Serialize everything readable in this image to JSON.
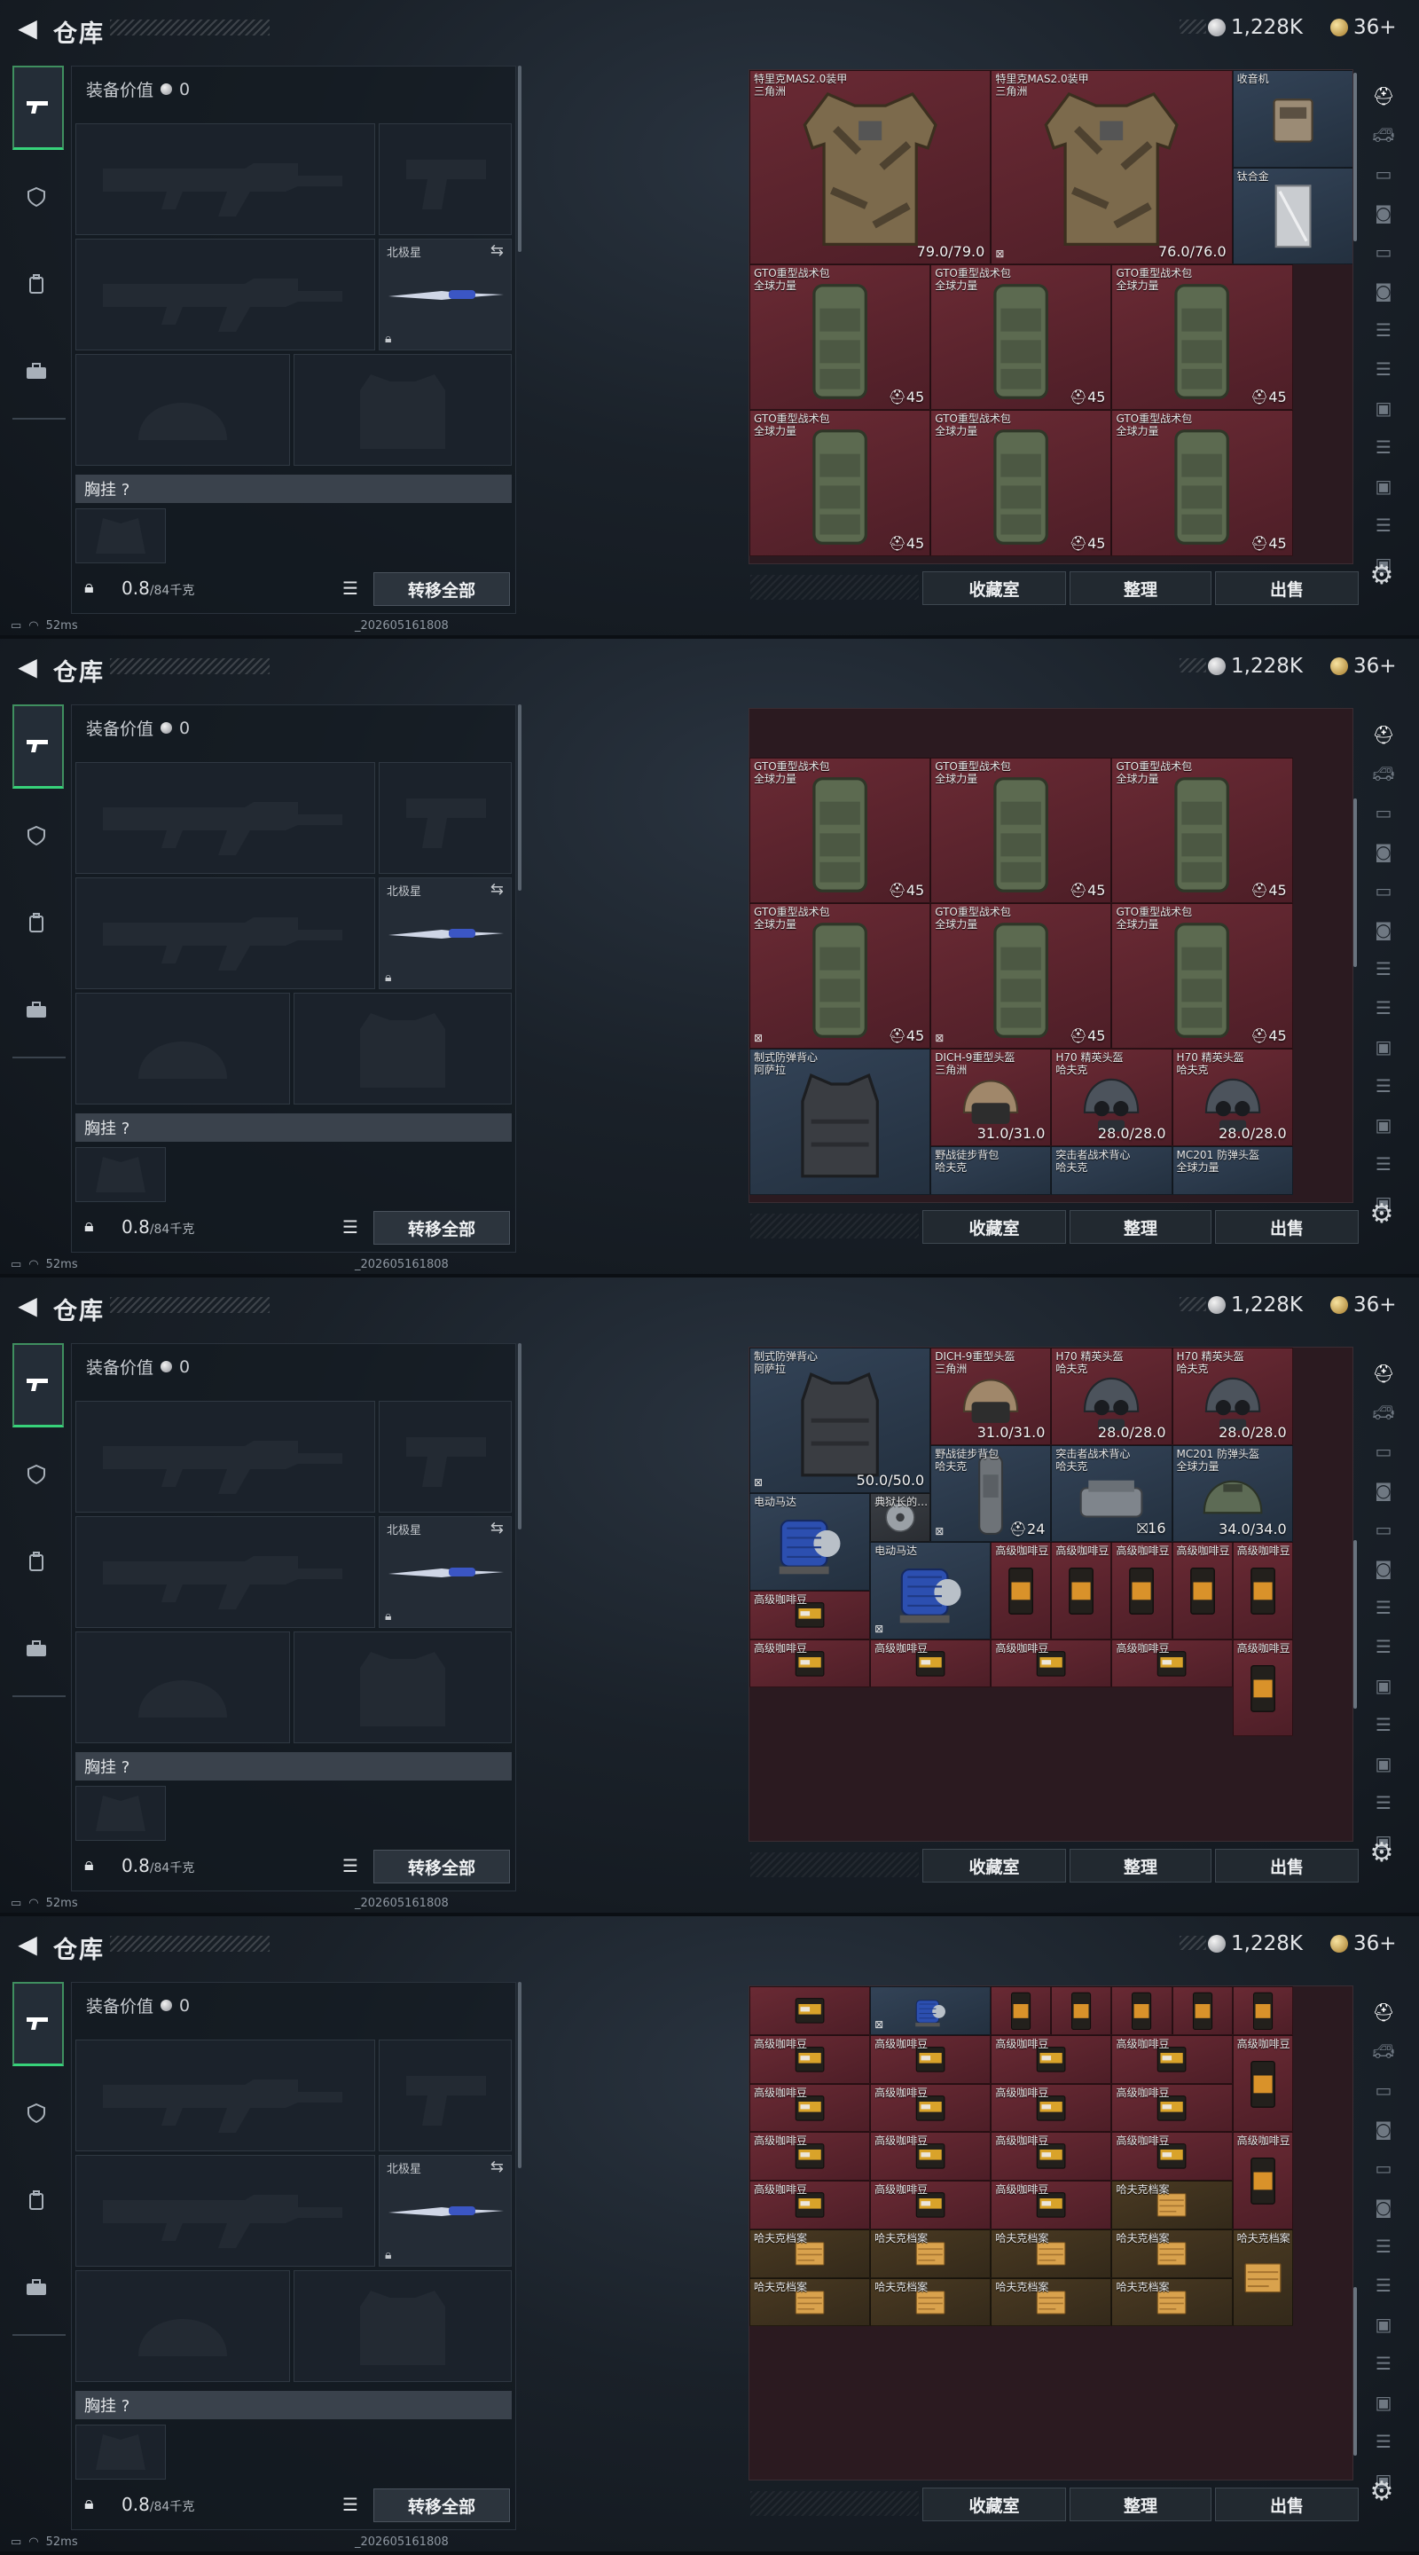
{
  "header": {
    "back_icon": "back-arrow-icon",
    "title": "仓库"
  },
  "currency": {
    "silver": "1,228K",
    "gold": "36+"
  },
  "sidebar": {
    "tabs": [
      {
        "icon": "gun-icon",
        "active": true
      },
      {
        "icon": "shield-badge-icon",
        "active": false
      },
      {
        "icon": "backpack-icon",
        "active": false
      },
      {
        "icon": "briefcase-icon",
        "active": false
      }
    ]
  },
  "equipment": {
    "value_label": "装备价值",
    "value": "0",
    "knife_label": "北极星",
    "chest_label": "胸挂 ?",
    "weight": "0.8",
    "weight_unit": "/84千克",
    "transfer_all": "转移全部"
  },
  "actions": {
    "collect": "收藏室",
    "sort": "整理",
    "sell": "出售"
  },
  "status": {
    "ping": "52ms",
    "build": "_202605161808"
  },
  "right_rail": [
    "helmet-icon",
    "car-icon",
    "tv-icon",
    "camera-icon",
    "tv-icon",
    "camera-icon",
    "server-icon",
    "server-icon",
    "image-icon",
    "server-icon",
    "image-icon",
    "server-icon",
    "image-icon"
  ],
  "colors": {
    "accent_green": "#37d27a",
    "rarity_red": "#5b222c",
    "rarity_blue": "#2b3a4c",
    "rarity_yellow": "#3f3220"
  },
  "frames": [
    {
      "scroll_offset": 0,
      "items": [
        {
          "r": 0,
          "c": 0,
          "w": 2,
          "h": 2,
          "name": "特里克MAS2.0装甲",
          "sub": "三角洲",
          "kind": "armor-camo",
          "rarity": "red",
          "val": "79.0/79.0"
        },
        {
          "r": 0,
          "c": 2,
          "w": 2,
          "h": 2,
          "name": "特里克MAS2.0装甲",
          "sub": "三角洲",
          "kind": "armor-camo",
          "rarity": "red",
          "val": "76.0/76.0",
          "icon": "⊠"
        },
        {
          "r": 0,
          "c": 4,
          "w": 1,
          "h": 1,
          "name": "收音机",
          "sub": "",
          "kind": "radio",
          "rarity": "blue",
          "val": ""
        },
        {
          "r": 1,
          "c": 4,
          "w": 1,
          "h": 1,
          "name": "钛合金",
          "sub": "",
          "kind": "metal",
          "rarity": "blue",
          "val": ""
        },
        {
          "r": 2,
          "c": 0,
          "w": 1.5,
          "h": 1.5,
          "name": "GTO重型战术包",
          "sub": "全球力量",
          "kind": "backpack",
          "rarity": "red",
          "val": "⛑45"
        },
        {
          "r": 2,
          "c": 1.5,
          "w": 1.5,
          "h": 1.5,
          "name": "GTO重型战术包",
          "sub": "全球力量",
          "kind": "backpack",
          "rarity": "red",
          "val": "⛑45"
        },
        {
          "r": 2,
          "c": 3,
          "w": 1.5,
          "h": 1.5,
          "name": "GTO重型战术包",
          "sub": "全球力量",
          "kind": "backpack",
          "rarity": "red",
          "val": "⛑45"
        },
        {
          "r": 3.5,
          "c": 0,
          "w": 1.5,
          "h": 1.5,
          "name": "GTO重型战术包",
          "sub": "全球力量",
          "kind": "backpack",
          "rarity": "red",
          "val": "⛑45"
        },
        {
          "r": 3.5,
          "c": 1.5,
          "w": 1.5,
          "h": 1.5,
          "name": "GTO重型战术包",
          "sub": "全球力量",
          "kind": "backpack",
          "rarity": "red",
          "val": "⛑45"
        },
        {
          "r": 3.5,
          "c": 3,
          "w": 1.5,
          "h": 1.5,
          "name": "GTO重型战术包",
          "sub": "全球力量",
          "kind": "backpack",
          "rarity": "red",
          "val": "⛑45"
        }
      ]
    },
    {
      "scroll_offset": 1.6,
      "items": [
        {
          "r": 0.5,
          "c": 0,
          "w": 1.5,
          "h": 1.5,
          "name": "GTO重型战术包",
          "sub": "全球力量",
          "kind": "backpack",
          "rarity": "red",
          "val": "⛑45"
        },
        {
          "r": 0.5,
          "c": 1.5,
          "w": 1.5,
          "h": 1.5,
          "name": "GTO重型战术包",
          "sub": "全球力量",
          "kind": "backpack",
          "rarity": "red",
          "val": "⛑45"
        },
        {
          "r": 0.5,
          "c": 3,
          "w": 1.5,
          "h": 1.5,
          "name": "GTO重型战术包",
          "sub": "全球力量",
          "kind": "backpack",
          "rarity": "red",
          "val": "⛑45"
        },
        {
          "r": 2,
          "c": 0,
          "w": 1.5,
          "h": 1.5,
          "name": "GTO重型战术包",
          "sub": "全球力量",
          "kind": "backpack",
          "rarity": "red",
          "val": "⛑45",
          "icon": "⊠"
        },
        {
          "r": 2,
          "c": 1.5,
          "w": 1.5,
          "h": 1.5,
          "name": "GTO重型战术包",
          "sub": "全球力量",
          "kind": "backpack",
          "rarity": "red",
          "val": "⛑45",
          "icon": "⊠"
        },
        {
          "r": 2,
          "c": 3,
          "w": 1.5,
          "h": 1.5,
          "name": "GTO重型战术包",
          "sub": "全球力量",
          "kind": "backpack",
          "rarity": "red",
          "val": "⛑45"
        },
        {
          "r": 3.5,
          "c": 0,
          "w": 1.5,
          "h": 1.5,
          "name": "制式防弹背心",
          "sub": "阿萨拉",
          "kind": "vest",
          "rarity": "blue",
          "val": ""
        },
        {
          "r": 3.5,
          "c": 1.5,
          "w": 1,
          "h": 1,
          "name": "DICH-9重型头盔",
          "sub": "三角洲",
          "kind": "helmet-tan",
          "rarity": "red",
          "val": "31.0/31.0"
        },
        {
          "r": 3.5,
          "c": 2.5,
          "w": 1,
          "h": 1,
          "name": "H70 精英头盔",
          "sub": "哈夫克",
          "kind": "helmet-dark",
          "rarity": "red",
          "val": "28.0/28.0"
        },
        {
          "r": 3.5,
          "c": 3.5,
          "w": 1,
          "h": 1,
          "name": "H70 精英头盔",
          "sub": "哈夫克",
          "kind": "helmet-dark",
          "rarity": "red",
          "val": "28.0/28.0"
        },
        {
          "r": 4.5,
          "c": 1.5,
          "w": 1,
          "h": 0.5,
          "name": "野战徒步背包",
          "sub": "哈夫克",
          "kind": "none",
          "rarity": "blue",
          "val": ""
        },
        {
          "r": 4.5,
          "c": 2.5,
          "w": 1,
          "h": 0.5,
          "name": "突击者战术背心",
          "sub": "哈夫克",
          "kind": "none",
          "rarity": "blue",
          "val": ""
        },
        {
          "r": 4.5,
          "c": 3.5,
          "w": 1,
          "h": 0.5,
          "name": "MC201 防弹头盔",
          "sub": "全球力量",
          "kind": "none",
          "rarity": "blue",
          "val": ""
        }
      ]
    },
    {
      "scroll_offset": 3.5,
      "items": [
        {
          "r": 0,
          "c": 0,
          "w": 1.5,
          "h": 1.5,
          "name": "制式防弹背心",
          "sub": "阿萨拉",
          "kind": "vest",
          "rarity": "blue",
          "val": "50.0/50.0",
          "icon": "⊠"
        },
        {
          "r": 0,
          "c": 1.5,
          "w": 1,
          "h": 1,
          "name": "DICH-9重型头盔",
          "sub": "三角洲",
          "kind": "helmet-tan",
          "rarity": "red",
          "val": "31.0/31.0"
        },
        {
          "r": 0,
          "c": 2.5,
          "w": 1,
          "h": 1,
          "name": "H70 精英头盔",
          "sub": "哈夫克",
          "kind": "helmet-dark",
          "rarity": "red",
          "val": "28.0/28.0"
        },
        {
          "r": 0,
          "c": 3.5,
          "w": 1,
          "h": 1,
          "name": "H70 精英头盔",
          "sub": "哈夫克",
          "kind": "helmet-dark",
          "rarity": "red",
          "val": "28.0/28.0"
        },
        {
          "r": 1,
          "c": 1.5,
          "w": 1,
          "h": 1,
          "name": "野战徒步背包",
          "sub": "哈夫克",
          "kind": "bag-gray",
          "rarity": "blue",
          "val": "⛑24",
          "icon": "⊠"
        },
        {
          "r": 1,
          "c": 2.5,
          "w": 1,
          "h": 1,
          "name": "突击者战术背心",
          "sub": "哈夫克",
          "kind": "vest-gray",
          "rarity": "blue",
          "val": "⛝16"
        },
        {
          "r": 1,
          "c": 3.5,
          "w": 1,
          "h": 1,
          "name": "MC201 防弹头盔",
          "sub": "全球力量",
          "kind": "helmet-green",
          "rarity": "blue",
          "val": "34.0/34.0"
        },
        {
          "r": 1.5,
          "c": 0,
          "w": 1,
          "h": 1,
          "name": "电动马达",
          "sub": "",
          "kind": "motor",
          "rarity": "blue",
          "val": ""
        },
        {
          "r": 1.5,
          "c": 1,
          "w": 0.5,
          "h": 0.5,
          "name": "典狱长的…",
          "sub": "",
          "kind": "disc",
          "rarity": "gray",
          "val": ""
        },
        {
          "r": 2,
          "c": 1,
          "w": 1,
          "h": 1,
          "name": "电动马达",
          "sub": "",
          "kind": "motor",
          "rarity": "blue",
          "val": "",
          "icon": "⊠"
        },
        {
          "r": 2,
          "c": 2,
          "w": 0.5,
          "h": 1,
          "name": "高级咖啡豆",
          "sub": "",
          "kind": "coffee-tall",
          "rarity": "red",
          "val": ""
        },
        {
          "r": 2,
          "c": 2.5,
          "w": 0.5,
          "h": 1,
          "name": "高级咖啡豆",
          "sub": "",
          "kind": "coffee-tall",
          "rarity": "red",
          "val": ""
        },
        {
          "r": 2,
          "c": 3,
          "w": 0.5,
          "h": 1,
          "name": "高级咖啡豆",
          "sub": "",
          "kind": "coffee-tall",
          "rarity": "red",
          "val": ""
        },
        {
          "r": 2,
          "c": 3.5,
          "w": 0.5,
          "h": 1,
          "name": "高级咖啡豆",
          "sub": "",
          "kind": "coffee-tall",
          "rarity": "red",
          "val": ""
        },
        {
          "r": 2,
          "c": 4,
          "w": 0.5,
          "h": 1,
          "name": "高级咖啡豆",
          "sub": "",
          "kind": "coffee-tall",
          "rarity": "red",
          "val": ""
        },
        {
          "r": 2.5,
          "c": 0,
          "w": 1,
          "h": 0.5,
          "name": "高级咖啡豆",
          "sub": "",
          "kind": "coffee",
          "rarity": "red",
          "val": ""
        },
        {
          "r": 3,
          "c": 0,
          "w": 1,
          "h": 0.5,
          "name": "高级咖啡豆",
          "sub": "",
          "kind": "coffee",
          "rarity": "red",
          "val": ""
        },
        {
          "r": 3,
          "c": 1,
          "w": 1,
          "h": 0.5,
          "name": "高级咖啡豆",
          "sub": "",
          "kind": "coffee",
          "rarity": "red",
          "val": ""
        },
        {
          "r": 3,
          "c": 2,
          "w": 1,
          "h": 0.5,
          "name": "高级咖啡豆",
          "sub": "",
          "kind": "coffee",
          "rarity": "red",
          "val": ""
        },
        {
          "r": 3,
          "c": 3,
          "w": 1,
          "h": 0.5,
          "name": "高级咖啡豆",
          "sub": "",
          "kind": "coffee",
          "rarity": "red",
          "val": ""
        },
        {
          "r": 3,
          "c": 4,
          "w": 0.5,
          "h": 1,
          "name": "高级咖啡豆",
          "sub": "",
          "kind": "coffee-tall",
          "rarity": "red",
          "val": ""
        }
      ]
    },
    {
      "scroll_offset": 5.5,
      "items": [
        {
          "r": 0,
          "c": 0,
          "w": 1,
          "h": 0.5,
          "name": "",
          "sub": "",
          "kind": "coffee",
          "rarity": "red",
          "val": ""
        },
        {
          "r": 0,
          "c": 1,
          "w": 1,
          "h": 0.5,
          "name": "",
          "sub": "",
          "kind": "motor",
          "rarity": "blue",
          "val": "",
          "icon": "⊠"
        },
        {
          "r": 0,
          "c": 2,
          "w": 0.5,
          "h": 0.5,
          "name": "",
          "sub": "",
          "kind": "coffee-tall",
          "rarity": "red",
          "val": ""
        },
        {
          "r": 0,
          "c": 2.5,
          "w": 0.5,
          "h": 0.5,
          "name": "",
          "sub": "",
          "kind": "coffee-tall",
          "rarity": "red",
          "val": ""
        },
        {
          "r": 0,
          "c": 3,
          "w": 0.5,
          "h": 0.5,
          "name": "",
          "sub": "",
          "kind": "coffee-tall",
          "rarity": "red",
          "val": ""
        },
        {
          "r": 0,
          "c": 3.5,
          "w": 0.5,
          "h": 0.5,
          "name": "",
          "sub": "",
          "kind": "coffee-tall",
          "rarity": "red",
          "val": ""
        },
        {
          "r": 0,
          "c": 4,
          "w": 0.5,
          "h": 0.5,
          "name": "",
          "sub": "",
          "kind": "coffee-tall",
          "rarity": "red",
          "val": ""
        },
        {
          "r": 0.5,
          "c": 0,
          "w": 1,
          "h": 0.5,
          "name": "高级咖啡豆",
          "sub": "",
          "kind": "coffee",
          "rarity": "red",
          "val": ""
        },
        {
          "r": 0.5,
          "c": 1,
          "w": 1,
          "h": 0.5,
          "name": "高级咖啡豆",
          "sub": "",
          "kind": "coffee",
          "rarity": "red",
          "val": ""
        },
        {
          "r": 0.5,
          "c": 2,
          "w": 1,
          "h": 0.5,
          "name": "高级咖啡豆",
          "sub": "",
          "kind": "coffee",
          "rarity": "red",
          "val": ""
        },
        {
          "r": 0.5,
          "c": 3,
          "w": 1,
          "h": 0.5,
          "name": "高级咖啡豆",
          "sub": "",
          "kind": "coffee",
          "rarity": "red",
          "val": ""
        },
        {
          "r": 0.5,
          "c": 4,
          "w": 0.5,
          "h": 1,
          "name": "高级咖啡豆",
          "sub": "",
          "kind": "coffee-tall",
          "rarity": "red",
          "val": ""
        },
        {
          "r": 1,
          "c": 0,
          "w": 1,
          "h": 0.5,
          "name": "高级咖啡豆",
          "sub": "",
          "kind": "coffee",
          "rarity": "red",
          "val": ""
        },
        {
          "r": 1,
          "c": 1,
          "w": 1,
          "h": 0.5,
          "name": "高级咖啡豆",
          "sub": "",
          "kind": "coffee",
          "rarity": "red",
          "val": ""
        },
        {
          "r": 1,
          "c": 2,
          "w": 1,
          "h": 0.5,
          "name": "高级咖啡豆",
          "sub": "",
          "kind": "coffee",
          "rarity": "red",
          "val": ""
        },
        {
          "r": 1,
          "c": 3,
          "w": 1,
          "h": 0.5,
          "name": "高级咖啡豆",
          "sub": "",
          "kind": "coffee",
          "rarity": "red",
          "val": ""
        },
        {
          "r": 1.5,
          "c": 0,
          "w": 1,
          "h": 0.5,
          "name": "高级咖啡豆",
          "sub": "",
          "kind": "coffee",
          "rarity": "red",
          "val": ""
        },
        {
          "r": 1.5,
          "c": 1,
          "w": 1,
          "h": 0.5,
          "name": "高级咖啡豆",
          "sub": "",
          "kind": "coffee",
          "rarity": "red",
          "val": ""
        },
        {
          "r": 1.5,
          "c": 2,
          "w": 1,
          "h": 0.5,
          "name": "高级咖啡豆",
          "sub": "",
          "kind": "coffee",
          "rarity": "red",
          "val": ""
        },
        {
          "r": 1.5,
          "c": 3,
          "w": 1,
          "h": 0.5,
          "name": "高级咖啡豆",
          "sub": "",
          "kind": "coffee",
          "rarity": "red",
          "val": ""
        },
        {
          "r": 1.5,
          "c": 4,
          "w": 0.5,
          "h": 1,
          "name": "高级咖啡豆",
          "sub": "",
          "kind": "coffee-tall",
          "rarity": "red",
          "val": ""
        },
        {
          "r": 2,
          "c": 0,
          "w": 1,
          "h": 0.5,
          "name": "高级咖啡豆",
          "sub": "",
          "kind": "coffee",
          "rarity": "red",
          "val": ""
        },
        {
          "r": 2,
          "c": 1,
          "w": 1,
          "h": 0.5,
          "name": "高级咖啡豆",
          "sub": "",
          "kind": "coffee",
          "rarity": "red",
          "val": ""
        },
        {
          "r": 2,
          "c": 2,
          "w": 1,
          "h": 0.5,
          "name": "高级咖啡豆",
          "sub": "",
          "kind": "coffee",
          "rarity": "red",
          "val": ""
        },
        {
          "r": 2,
          "c": 3,
          "w": 1,
          "h": 0.5,
          "name": "哈夫克档案",
          "sub": "",
          "kind": "docs",
          "rarity": "yellow",
          "val": ""
        },
        {
          "r": 2.5,
          "c": 0,
          "w": 1,
          "h": 0.5,
          "name": "哈夫克档案",
          "sub": "",
          "kind": "docs",
          "rarity": "yellow",
          "val": ""
        },
        {
          "r": 2.5,
          "c": 1,
          "w": 1,
          "h": 0.5,
          "name": "哈夫克档案",
          "sub": "",
          "kind": "docs",
          "rarity": "yellow",
          "val": ""
        },
        {
          "r": 2.5,
          "c": 2,
          "w": 1,
          "h": 0.5,
          "name": "哈夫克档案",
          "sub": "",
          "kind": "docs",
          "rarity": "yellow",
          "val": ""
        },
        {
          "r": 2.5,
          "c": 3,
          "w": 1,
          "h": 0.5,
          "name": "哈夫克档案",
          "sub": "",
          "kind": "docs",
          "rarity": "yellow",
          "val": ""
        },
        {
          "r": 2.5,
          "c": 4,
          "w": 0.5,
          "h": 1,
          "name": "哈夫克档案",
          "sub": "",
          "kind": "docs",
          "rarity": "yellow",
          "val": ""
        },
        {
          "r": 3,
          "c": 0,
          "w": 1,
          "h": 0.5,
          "name": "哈夫克档案",
          "sub": "",
          "kind": "docs",
          "rarity": "yellow",
          "val": ""
        },
        {
          "r": 3,
          "c": 1,
          "w": 1,
          "h": 0.5,
          "name": "哈夫克档案",
          "sub": "",
          "kind": "docs",
          "rarity": "yellow",
          "val": ""
        },
        {
          "r": 3,
          "c": 2,
          "w": 1,
          "h": 0.5,
          "name": "哈夫克档案",
          "sub": "",
          "kind": "docs",
          "rarity": "yellow",
          "val": ""
        },
        {
          "r": 3,
          "c": 3,
          "w": 1,
          "h": 0.5,
          "name": "哈夫克档案",
          "sub": "",
          "kind": "docs",
          "rarity": "yellow",
          "val": ""
        }
      ]
    }
  ]
}
